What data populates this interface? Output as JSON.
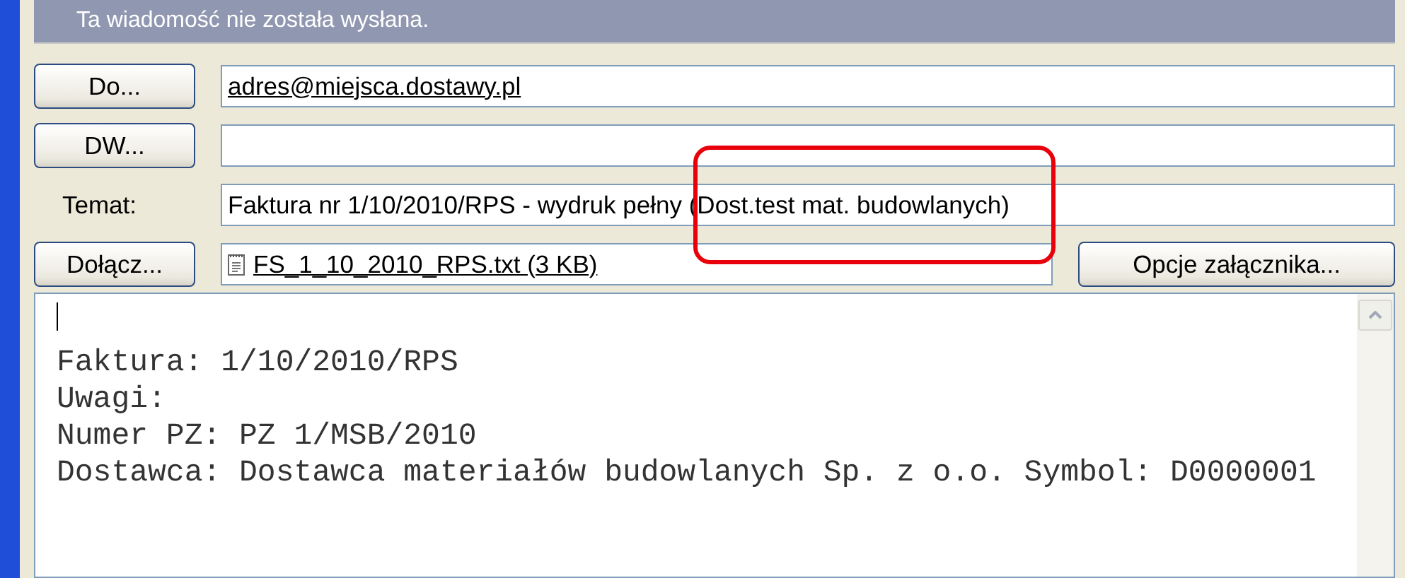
{
  "banner": {
    "text": "Ta wiadomość nie została wysłana."
  },
  "recipients": [
    {
      "button": "Do...",
      "value": "adres@miejsca.dostawy.pl"
    },
    {
      "button": "DW..."
    }
  ],
  "subject": {
    "label": "Temat:",
    "value": "Faktura nr 1/10/2010/RPS - wydruk pełny (Dost.test mat. budowlanych)"
  },
  "attach": {
    "button": "Dołącz...",
    "file": "FS_1_10_2010_RPS.txt (3 KB)",
    "options_button": "Opcje załącznika..."
  },
  "body": {
    "lines": [
      "Faktura: 1/10/2010/RPS",
      "Uwagi:",
      "Numer PZ: PZ 1/MSB/2010",
      "Dostawca: Dostawca materiałów budowlanych Sp. z o.o. Symbol: D0000001"
    ]
  }
}
